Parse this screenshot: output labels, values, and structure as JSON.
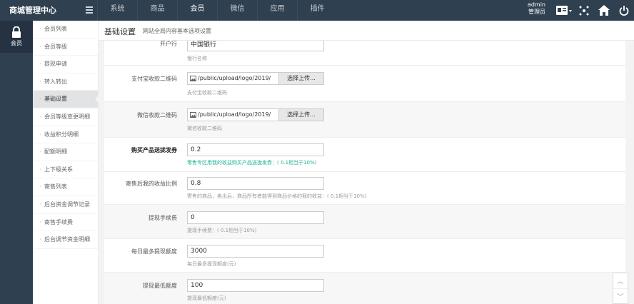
{
  "header": {
    "brand": "商城管理中心",
    "nav": [
      "系统",
      "商品",
      "会员",
      "微信",
      "应用",
      "插件"
    ],
    "active_nav": "会员",
    "admin_name": "admin",
    "admin_role": "管理员"
  },
  "rail": {
    "label": "会员"
  },
  "sidebar": {
    "items": [
      {
        "label": "会员列表"
      },
      {
        "label": "会员等级"
      },
      {
        "label": "提现申请"
      },
      {
        "label": "转入转出"
      },
      {
        "label": "基础设置",
        "active": true
      },
      {
        "label": "会员等级变更明细"
      },
      {
        "label": "收益积分明细"
      },
      {
        "label": "配额明细"
      },
      {
        "label": "上下级关系"
      },
      {
        "label": "寄售列表"
      },
      {
        "label": "后台资金调节记录"
      },
      {
        "label": "寄售手续费"
      },
      {
        "label": "后台调节资金明细"
      }
    ]
  },
  "page": {
    "title": "基础设置",
    "description": "网站全局内容基本选项设置"
  },
  "form": {
    "bank": {
      "label": "开户行",
      "value": "中国银行",
      "help": "银行名称"
    },
    "alipay_qr": {
      "label": "支付宝收款二维码",
      "path": "/public/upload/logo/2019/",
      "button": "选择上传...",
      "help": "支付宝收款二维码"
    },
    "wechat_qr": {
      "label": "微信收款二维码",
      "path": "/public/upload/logo/2019/",
      "button": "选择上传...",
      "help": "微信收款二维码"
    },
    "purchase_coupon": {
      "label": "购买产品送拢发券",
      "value": "0.2",
      "help": "零售专区用我的收益购买产品送拢发券：( 0.1相当于10%)"
    },
    "consign_ratio": {
      "label": "寄售后我的收益比例",
      "value": "0.8",
      "help": "寄售的商品，卖出后，商品所有者能得到商品价格的我的收益：( 0.1相当于10%)"
    },
    "withdraw_fee": {
      "label": "提现手续费",
      "value": "0",
      "help": "提现手续费：( 0.1相当于10%)"
    },
    "daily_max": {
      "label": "每日最多提现额度",
      "value": "3000",
      "help": "每日最多提现额度(元)"
    },
    "min_withdraw": {
      "label": "提现最低额度",
      "value": "100",
      "help": "提现最低额度(元)"
    }
  },
  "colors": {
    "topbar": "#2f4050",
    "accent_green": "#1ab394"
  }
}
